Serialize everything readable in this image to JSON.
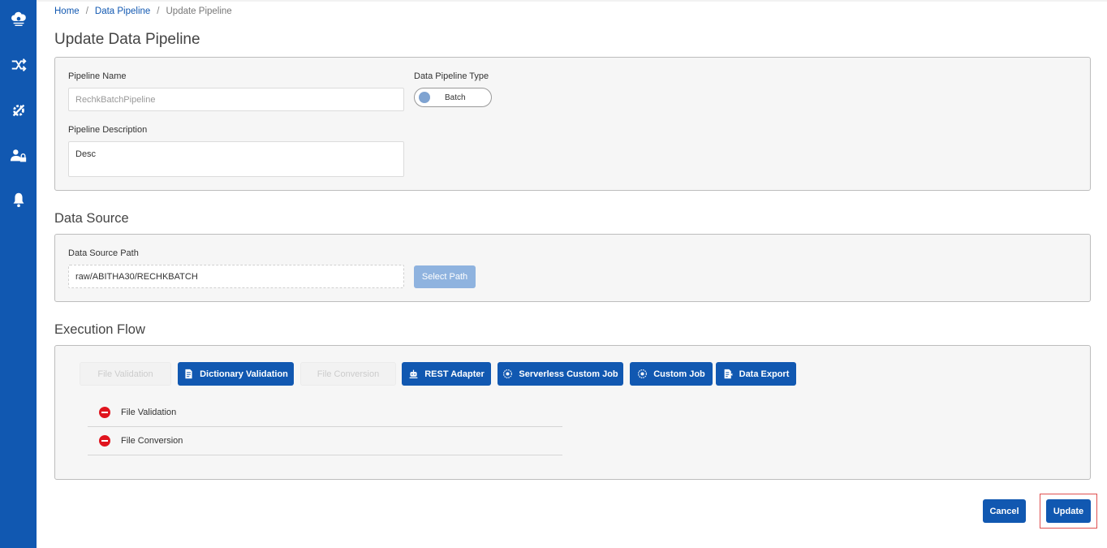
{
  "breadcrumb": {
    "home": "Home",
    "data_pipeline": "Data Pipeline",
    "current": "Update Pipeline"
  },
  "page_title": "Update Data Pipeline",
  "pipeline": {
    "name_label": "Pipeline Name",
    "name_value": "RechkBatchPipeline",
    "type_label": "Data Pipeline Type",
    "type_value": "Batch",
    "desc_label": "Pipeline Description",
    "desc_value": "Desc"
  },
  "data_source": {
    "title": "Data Source",
    "path_label": "Data Source Path",
    "path_value": "raw/ABITHA30/RECHKBATCH",
    "select_label": "Select Path"
  },
  "execution_flow": {
    "title": "Execution Flow",
    "buttons": [
      {
        "label": "File Validation",
        "state": "disabled"
      },
      {
        "label": "Dictionary Validation",
        "state": "active",
        "icon": "document-list-icon"
      },
      {
        "label": "File Conversion",
        "state": "disabled"
      },
      {
        "label": "REST Adapter",
        "state": "active",
        "icon": "robot-icon"
      },
      {
        "label": "Serverless Custom Job",
        "state": "active",
        "icon": "gear-globe-icon"
      },
      {
        "label": "Custom Job",
        "state": "active",
        "icon": "gear-globe-icon"
      },
      {
        "label": "Data Export",
        "state": "active",
        "icon": "export-document-icon"
      }
    ],
    "steps": [
      {
        "label": "File Validation"
      },
      {
        "label": "File Conversion"
      }
    ]
  },
  "actions": {
    "cancel": "Cancel",
    "update": "Update"
  },
  "colors": {
    "primary": "#1158b1",
    "remove": "#e0141e",
    "highlight": "#e05050"
  },
  "sidebar_icons": [
    "cloud-user-icon",
    "shuffle-icon",
    "tools-icon",
    "user-lock-icon",
    "bell-icon"
  ]
}
